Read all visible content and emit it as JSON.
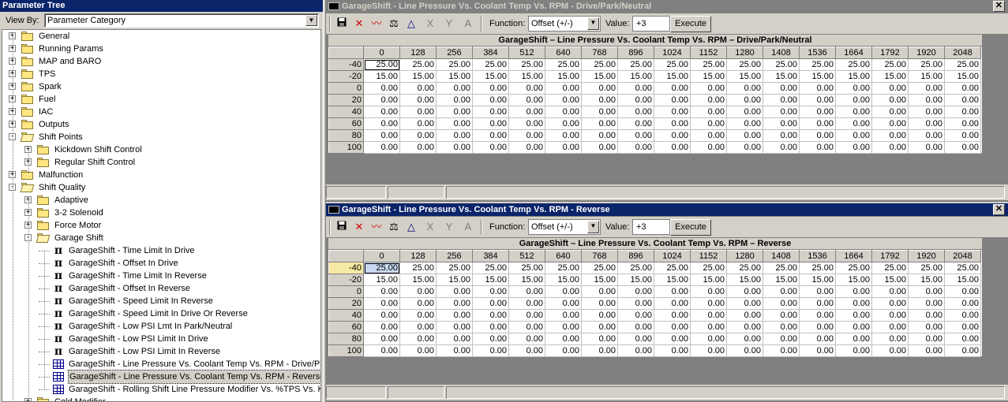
{
  "left": {
    "title": "Parameter Tree",
    "view_by_label": "View By:",
    "view_by_value": "Parameter Category",
    "tree": [
      {
        "label": "General",
        "level": 0,
        "kind": "folder",
        "expander": "+"
      },
      {
        "label": "Running Params",
        "level": 0,
        "kind": "folder",
        "expander": "+"
      },
      {
        "label": "MAP and BARO",
        "level": 0,
        "kind": "folder",
        "expander": "+"
      },
      {
        "label": "TPS",
        "level": 0,
        "kind": "folder",
        "expander": "+"
      },
      {
        "label": "Spark",
        "level": 0,
        "kind": "folder",
        "expander": "+"
      },
      {
        "label": "Fuel",
        "level": 0,
        "kind": "folder",
        "expander": "+"
      },
      {
        "label": "IAC",
        "level": 0,
        "kind": "folder",
        "expander": "+"
      },
      {
        "label": "Outputs",
        "level": 0,
        "kind": "folder",
        "expander": "+"
      },
      {
        "label": "Shift Points",
        "level": 0,
        "kind": "folder-open",
        "expander": "-"
      },
      {
        "label": "Kickdown Shift Control",
        "level": 1,
        "kind": "folder",
        "expander": "+"
      },
      {
        "label": "Regular Shift Control",
        "level": 1,
        "kind": "folder",
        "expander": "+"
      },
      {
        "label": "Malfunction",
        "level": 0,
        "kind": "folder",
        "expander": "+"
      },
      {
        "label": "Shift Quality",
        "level": 0,
        "kind": "folder-open",
        "expander": "-"
      },
      {
        "label": "Adaptive",
        "level": 1,
        "kind": "folder",
        "expander": "+"
      },
      {
        "label": "3-2 Solenoid",
        "level": 1,
        "kind": "folder",
        "expander": "+"
      },
      {
        "label": "Force Motor",
        "level": 1,
        "kind": "folder",
        "expander": "+"
      },
      {
        "label": "Garage Shift",
        "level": 1,
        "kind": "folder-open",
        "expander": "-"
      },
      {
        "label": "GarageShift - Time Limit In Drive",
        "level": 2,
        "kind": "pi"
      },
      {
        "label": "GarageShift - Offset In Drive",
        "level": 2,
        "kind": "pi"
      },
      {
        "label": "GarageShift - Time Limit In Reverse",
        "level": 2,
        "kind": "pi"
      },
      {
        "label": "GarageShift - Offset In Reverse",
        "level": 2,
        "kind": "pi"
      },
      {
        "label": "GarageShift - Speed Limit In Reverse",
        "level": 2,
        "kind": "pi"
      },
      {
        "label": "GarageShift - Speed Limit In Drive Or Reverse",
        "level": 2,
        "kind": "pi"
      },
      {
        "label": "GarageShift - Low PSI Lmt In Park/Neutral",
        "level": 2,
        "kind": "pi"
      },
      {
        "label": "GarageShift - Low PSI Limit In Drive",
        "level": 2,
        "kind": "pi"
      },
      {
        "label": "GarageShift - Low PSI Limit In Reverse",
        "level": 2,
        "kind": "pi"
      },
      {
        "label": "GarageShift - Line Pressure Vs. Coolant Temp Vs. RPM - Drive/Park/Neutral",
        "level": 2,
        "kind": "table"
      },
      {
        "label": "GarageShift - Line Pressure Vs. Coolant Temp Vs. RPM - Reverse",
        "level": 2,
        "kind": "table",
        "selected": true
      },
      {
        "label": "GarageShift - Rolling Shift Line Pressure Modifier Vs. %TPS Vs. KPH",
        "level": 2,
        "kind": "table"
      },
      {
        "label": "Cold Modifier",
        "level": 1,
        "kind": "folder",
        "expander": "+"
      }
    ]
  },
  "windows": [
    {
      "title": "GarageShift - Line Pressure Vs. Coolant Temp Vs. RPM - Drive/Park/Neutral",
      "active": false,
      "function_label": "Function:",
      "function_value": "Offset (+/-)",
      "value_label": "Value:",
      "value": "+3",
      "execute_label": "Execute",
      "table_title": "GarageShift – Line Pressure Vs. Coolant Temp Vs. RPM – Drive/Park/Neutral",
      "columns": [
        "0",
        "128",
        "256",
        "384",
        "512",
        "640",
        "768",
        "896",
        "1024",
        "1152",
        "1280",
        "1408",
        "1536",
        "1664",
        "1792",
        "1920",
        "2048"
      ],
      "rows": [
        {
          "label": "-40",
          "values": [
            "25.00",
            "25.00",
            "25.00",
            "25.00",
            "25.00",
            "25.00",
            "25.00",
            "25.00",
            "25.00",
            "25.00",
            "25.00",
            "25.00",
            "25.00",
            "25.00",
            "25.00",
            "25.00",
            "25.00"
          ]
        },
        {
          "label": "-20",
          "values": [
            "15.00",
            "15.00",
            "15.00",
            "15.00",
            "15.00",
            "15.00",
            "15.00",
            "15.00",
            "15.00",
            "15.00",
            "15.00",
            "15.00",
            "15.00",
            "15.00",
            "15.00",
            "15.00",
            "15.00"
          ]
        },
        {
          "label": "0",
          "values": [
            "0.00",
            "0.00",
            "0.00",
            "0.00",
            "0.00",
            "0.00",
            "0.00",
            "0.00",
            "0.00",
            "0.00",
            "0.00",
            "0.00",
            "0.00",
            "0.00",
            "0.00",
            "0.00",
            "0.00"
          ]
        },
        {
          "label": "20",
          "values": [
            "0.00",
            "0.00",
            "0.00",
            "0.00",
            "0.00",
            "0.00",
            "0.00",
            "0.00",
            "0.00",
            "0.00",
            "0.00",
            "0.00",
            "0.00",
            "0.00",
            "0.00",
            "0.00",
            "0.00"
          ]
        },
        {
          "label": "40",
          "values": [
            "0.00",
            "0.00",
            "0.00",
            "0.00",
            "0.00",
            "0.00",
            "0.00",
            "0.00",
            "0.00",
            "0.00",
            "0.00",
            "0.00",
            "0.00",
            "0.00",
            "0.00",
            "0.00",
            "0.00"
          ]
        },
        {
          "label": "60",
          "values": [
            "0.00",
            "0.00",
            "0.00",
            "0.00",
            "0.00",
            "0.00",
            "0.00",
            "0.00",
            "0.00",
            "0.00",
            "0.00",
            "0.00",
            "0.00",
            "0.00",
            "0.00",
            "0.00",
            "0.00"
          ]
        },
        {
          "label": "80",
          "values": [
            "0.00",
            "0.00",
            "0.00",
            "0.00",
            "0.00",
            "0.00",
            "0.00",
            "0.00",
            "0.00",
            "0.00",
            "0.00",
            "0.00",
            "0.00",
            "0.00",
            "0.00",
            "0.00",
            "0.00"
          ]
        },
        {
          "label": "100",
          "values": [
            "0.00",
            "0.00",
            "0.00",
            "0.00",
            "0.00",
            "0.00",
            "0.00",
            "0.00",
            "0.00",
            "0.00",
            "0.00",
            "0.00",
            "0.00",
            "0.00",
            "0.00",
            "0.00",
            "0.00"
          ]
        }
      ]
    },
    {
      "title": "GarageShift - Line Pressure Vs. Coolant Temp Vs. RPM - Reverse",
      "active": true,
      "function_label": "Function:",
      "function_value": "Offset (+/-)",
      "value_label": "Value:",
      "value": "+3",
      "execute_label": "Execute",
      "table_title": "GarageShift – Line Pressure Vs. Coolant Temp Vs. RPM – Reverse",
      "columns": [
        "0",
        "128",
        "256",
        "384",
        "512",
        "640",
        "768",
        "896",
        "1024",
        "1152",
        "1280",
        "1408",
        "1536",
        "1664",
        "1792",
        "1920",
        "2048"
      ],
      "rows": [
        {
          "label": "-40",
          "values": [
            "25.00",
            "25.00",
            "25.00",
            "25.00",
            "25.00",
            "25.00",
            "25.00",
            "25.00",
            "25.00",
            "25.00",
            "25.00",
            "25.00",
            "25.00",
            "25.00",
            "25.00",
            "25.00",
            "25.00"
          ]
        },
        {
          "label": "-20",
          "values": [
            "15.00",
            "15.00",
            "15.00",
            "15.00",
            "15.00",
            "15.00",
            "15.00",
            "15.00",
            "15.00",
            "15.00",
            "15.00",
            "15.00",
            "15.00",
            "15.00",
            "15.00",
            "15.00",
            "15.00"
          ]
        },
        {
          "label": "0",
          "values": [
            "0.00",
            "0.00",
            "0.00",
            "0.00",
            "0.00",
            "0.00",
            "0.00",
            "0.00",
            "0.00",
            "0.00",
            "0.00",
            "0.00",
            "0.00",
            "0.00",
            "0.00",
            "0.00",
            "0.00"
          ]
        },
        {
          "label": "20",
          "values": [
            "0.00",
            "0.00",
            "0.00",
            "0.00",
            "0.00",
            "0.00",
            "0.00",
            "0.00",
            "0.00",
            "0.00",
            "0.00",
            "0.00",
            "0.00",
            "0.00",
            "0.00",
            "0.00",
            "0.00"
          ]
        },
        {
          "label": "40",
          "values": [
            "0.00",
            "0.00",
            "0.00",
            "0.00",
            "0.00",
            "0.00",
            "0.00",
            "0.00",
            "0.00",
            "0.00",
            "0.00",
            "0.00",
            "0.00",
            "0.00",
            "0.00",
            "0.00",
            "0.00"
          ]
        },
        {
          "label": "60",
          "values": [
            "0.00",
            "0.00",
            "0.00",
            "0.00",
            "0.00",
            "0.00",
            "0.00",
            "0.00",
            "0.00",
            "0.00",
            "0.00",
            "0.00",
            "0.00",
            "0.00",
            "0.00",
            "0.00",
            "0.00"
          ]
        },
        {
          "label": "80",
          "values": [
            "0.00",
            "0.00",
            "0.00",
            "0.00",
            "0.00",
            "0.00",
            "0.00",
            "0.00",
            "0.00",
            "0.00",
            "0.00",
            "0.00",
            "0.00",
            "0.00",
            "0.00",
            "0.00",
            "0.00"
          ]
        },
        {
          "label": "100",
          "values": [
            "0.00",
            "0.00",
            "0.00",
            "0.00",
            "0.00",
            "0.00",
            "0.00",
            "0.00",
            "0.00",
            "0.00",
            "0.00",
            "0.00",
            "0.00",
            "0.00",
            "0.00",
            "0.00",
            "0.00"
          ]
        }
      ]
    }
  ],
  "icons": {
    "save": "save-icon",
    "delete": "red-x-icon",
    "graph": "graph-icon",
    "balance": "scales-icon",
    "triangle": "triangle-icon",
    "multiply": "x-icon",
    "split": "arrows-icon",
    "font": "font-icon"
  },
  "colors": {
    "active_title": "#0a246a",
    "inactive_title": "#808080",
    "highlight_row_header": "#f6e9a3"
  }
}
